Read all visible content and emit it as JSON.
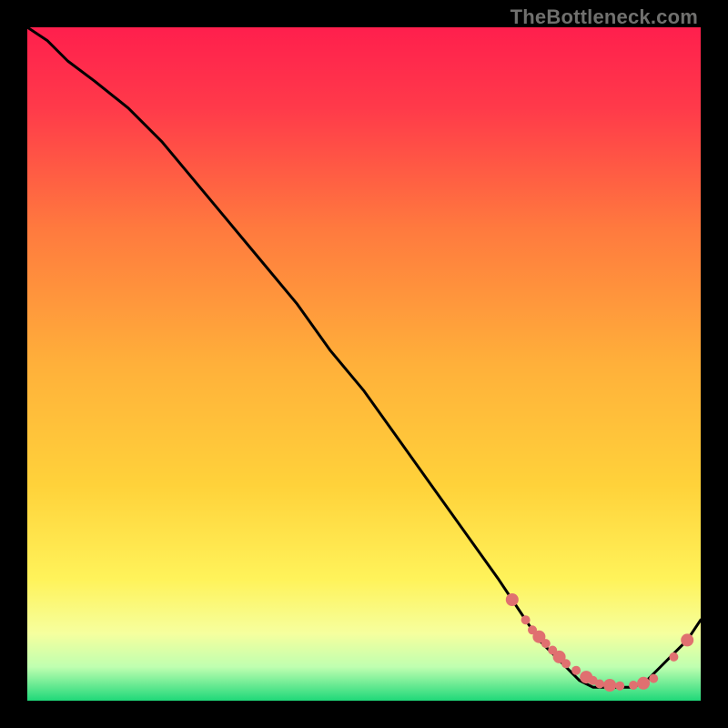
{
  "watermark": "TheBottleneck.com",
  "colors": {
    "background_black": "#000000",
    "gradient_top": "#ff1f4d",
    "gradient_mid": "#ffd23a",
    "gradient_low": "#f6ff9e",
    "gradient_bottom": "#1fd879",
    "curve_stroke": "#000000",
    "point_fill": "#e07070"
  },
  "chart_data": {
    "type": "line",
    "title": "",
    "xlabel": "",
    "ylabel": "",
    "xlim": [
      0,
      100
    ],
    "ylim": [
      0,
      100
    ],
    "series": [
      {
        "name": "curve",
        "x": [
          0,
          3,
          6,
          10,
          15,
          20,
          25,
          30,
          35,
          40,
          45,
          50,
          55,
          60,
          65,
          70,
          72,
          74,
          76,
          78,
          80,
          82,
          84,
          86,
          88,
          90,
          92,
          94,
          96,
          98,
          100
        ],
        "y": [
          100,
          98,
          95,
          92,
          88,
          83,
          77,
          71,
          65,
          59,
          52,
          46,
          39,
          32,
          25,
          18,
          15,
          12,
          9,
          7,
          5,
          3,
          2,
          2,
          2,
          2,
          3,
          5,
          7,
          9,
          12
        ]
      }
    ],
    "markers": {
      "name": "highlight-points",
      "x": [
        72,
        74,
        75,
        76,
        77,
        78,
        79,
        80,
        81.5,
        83,
        84,
        85,
        86.5,
        88,
        90,
        91.5,
        93,
        96,
        98
      ],
      "y": [
        15,
        12,
        10.5,
        9.5,
        8.5,
        7.5,
        6.5,
        5.5,
        4.5,
        3.5,
        3,
        2.5,
        2.3,
        2.2,
        2.3,
        2.6,
        3.3,
        6.5,
        9
      ]
    }
  }
}
